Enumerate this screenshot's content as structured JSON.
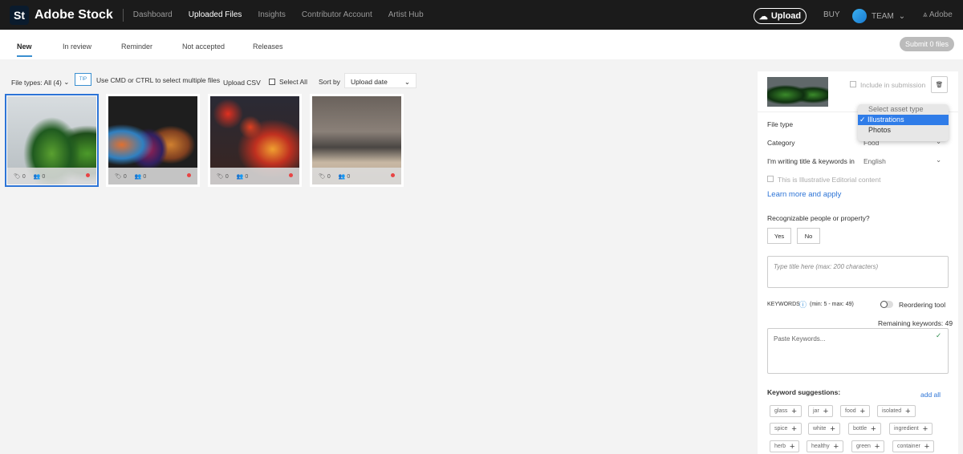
{
  "header": {
    "logo": "St",
    "brand": "Adobe Stock",
    "nav": [
      "Dashboard",
      "Uploaded Files",
      "Insights",
      "Contributor Account",
      "Artist Hub"
    ],
    "upload": "Upload",
    "buy": "BUY",
    "team": "TEAM",
    "adobe": "Adobe"
  },
  "tabs": [
    "New",
    "In review",
    "Reminder",
    "Not accepted",
    "Releases"
  ],
  "submit": "Submit 0 files",
  "toolbar": {
    "file_types": "File types: All (4)",
    "tip": "TIP",
    "tip_text": "Use CMD or CTRL to select multiple files",
    "upload_csv": "Upload CSV",
    "select_all": "Select All",
    "sort_by": "Sort by",
    "sort_value": "Upload date"
  },
  "thumbs": [
    {
      "keywords": "0",
      "people": "0"
    },
    {
      "keywords": "0",
      "people": "0"
    },
    {
      "keywords": "0",
      "people": "0"
    },
    {
      "keywords": "0",
      "people": "0"
    }
  ],
  "panel": {
    "include": "Include in submission",
    "file_type": "File type",
    "category": "Category",
    "category_value": "Food",
    "language_label": "I'm writing title & keywords in",
    "language_value": "English",
    "editorial": "This is Illustrative Editorial content",
    "learn_more": "Learn more and apply",
    "people_q": "Recognizable people or property?",
    "yes": "Yes",
    "no": "No",
    "title_placeholder": "Type title here (max: 200 characters)",
    "keywords_label": "KEYWORDS",
    "keywords_range": "(min: 5 - max: 49)",
    "reorder": "Reordering tool",
    "remaining": "Remaining keywords: 49",
    "keywords_placeholder": "Paste Keywords...",
    "suggestions": "Keyword suggestions:",
    "add_all": "add all",
    "chips": [
      "glass",
      "jar",
      "food",
      "isolated",
      "spice",
      "white",
      "bottle",
      "ingredient",
      "herb",
      "healthy",
      "green",
      "container"
    ]
  },
  "dropdown": {
    "header": "Select asset type",
    "options": [
      "Illustrations",
      "Photos"
    ],
    "selected": "Illustrations"
  },
  "colors": {
    "accent": "#2d74d6",
    "header_bg": "#1b1b1b"
  }
}
